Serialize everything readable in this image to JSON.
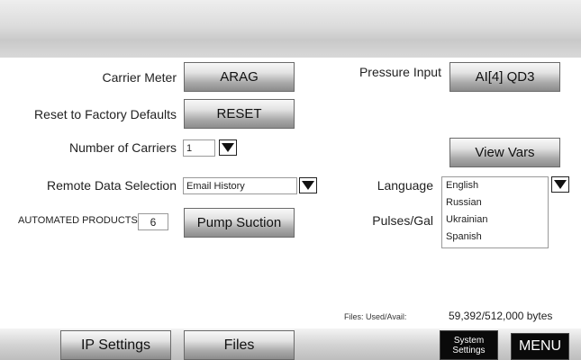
{
  "settings": {
    "carrier_meter": {
      "label": "Carrier Meter",
      "button": "ARAG"
    },
    "reset_defaults": {
      "label": "Reset to Factory Defaults",
      "button": "RESET"
    },
    "num_carriers": {
      "label": "Number of Carriers",
      "value": "1"
    },
    "remote_data": {
      "label": "Remote Data Selection",
      "value": "Email History"
    },
    "automated_products": {
      "label": "AUTOMATED PRODUCTS",
      "value": "6",
      "button": "Pump Suction"
    },
    "pressure_input": {
      "label": "Pressure Input",
      "button": "AI[4]  QD3"
    },
    "view_vars": {
      "button": "View Vars"
    },
    "language": {
      "label": "Language",
      "options": [
        "English",
        "Russian",
        "Ukrainian",
        "Spanish"
      ]
    },
    "pulses_gal": {
      "label": "Pulses/Gal"
    },
    "files": {
      "label": "Files: Used/Avail:",
      "value": "59,392/512,000 bytes"
    }
  },
  "bottom": {
    "ip_settings": "IP Settings",
    "files": "Files",
    "system_settings": "System\nSettings",
    "menu": "MENU"
  }
}
